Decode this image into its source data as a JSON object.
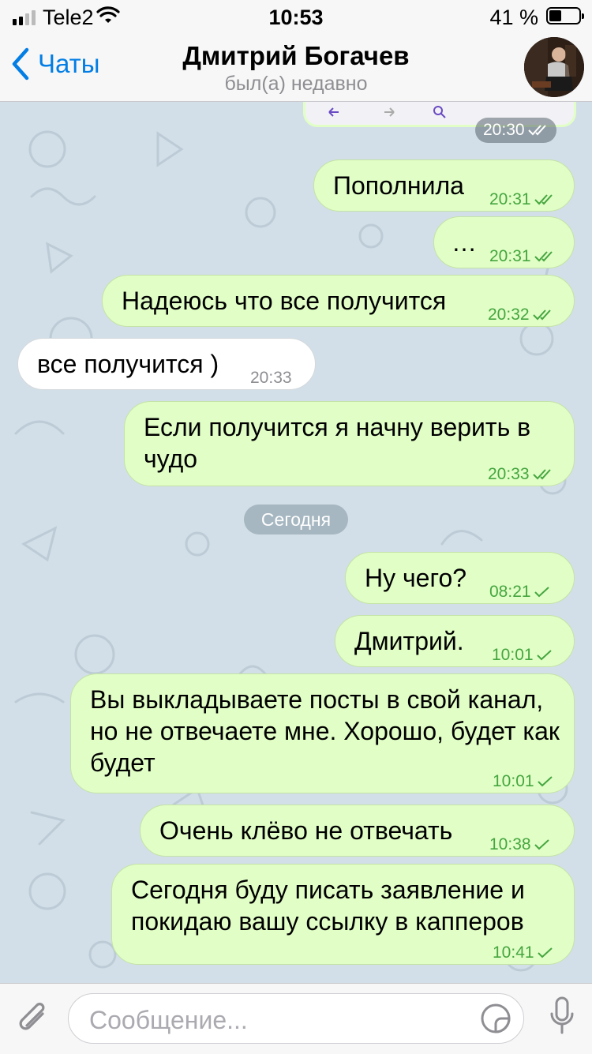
{
  "status_bar": {
    "carrier": "Tele2",
    "time": "10:53",
    "battery": "41 %",
    "battery_level": 0.41
  },
  "header": {
    "back_label": "Чаты",
    "contact_name": "Дмитрий Богачев",
    "last_seen": "был(а) недавно"
  },
  "messages": [
    {
      "dir": "out",
      "text": "",
      "time": "20:30",
      "status": "read",
      "kind": "image-screenshot"
    },
    {
      "dir": "out",
      "text": "Пополнила",
      "time": "20:31",
      "status": "read"
    },
    {
      "dir": "out",
      "text": "…",
      "time": "20:31",
      "status": "read"
    },
    {
      "dir": "out",
      "text": "Надеюсь что все получится",
      "time": "20:32",
      "status": "read"
    },
    {
      "dir": "in",
      "text": "все получится )",
      "time": "20:33"
    },
    {
      "dir": "out",
      "text": "Если получится я начну верить в чудо",
      "time": "20:33",
      "status": "read"
    },
    {
      "dir": "out",
      "text": "Ну чего?",
      "time": "08:21",
      "status": "sent"
    },
    {
      "dir": "out",
      "text": "Дмитрий.",
      "time": "10:01",
      "status": "sent"
    },
    {
      "dir": "out",
      "text": "Вы выкладываете посты в свой канал, но не отвечаете мне. Хорошо, будет как будет",
      "time": "10:01",
      "status": "sent"
    },
    {
      "dir": "out",
      "text": "Очень клёво не отвечать",
      "time": "10:38",
      "status": "sent"
    },
    {
      "dir": "out",
      "text": "Сегодня буду писать заявление и покидаю вашу ссылку в капперов",
      "time": "10:41",
      "status": "sent"
    }
  ],
  "date_divider": "Сегодня",
  "input": {
    "placeholder": "Сообщение..."
  },
  "colors": {
    "accent": "#037ee5",
    "outgoing_bubble": "#e1fec6",
    "incoming_bubble": "#ffffff",
    "outgoing_meta": "#45a63f",
    "wallpaper": "#d2dfe8"
  },
  "icons": [
    "signal-icon",
    "wifi-icon",
    "battery-icon",
    "chevron-left-icon",
    "paperclip-icon",
    "sticker-icon",
    "microphone-icon",
    "double-check-icon",
    "check-icon"
  ]
}
